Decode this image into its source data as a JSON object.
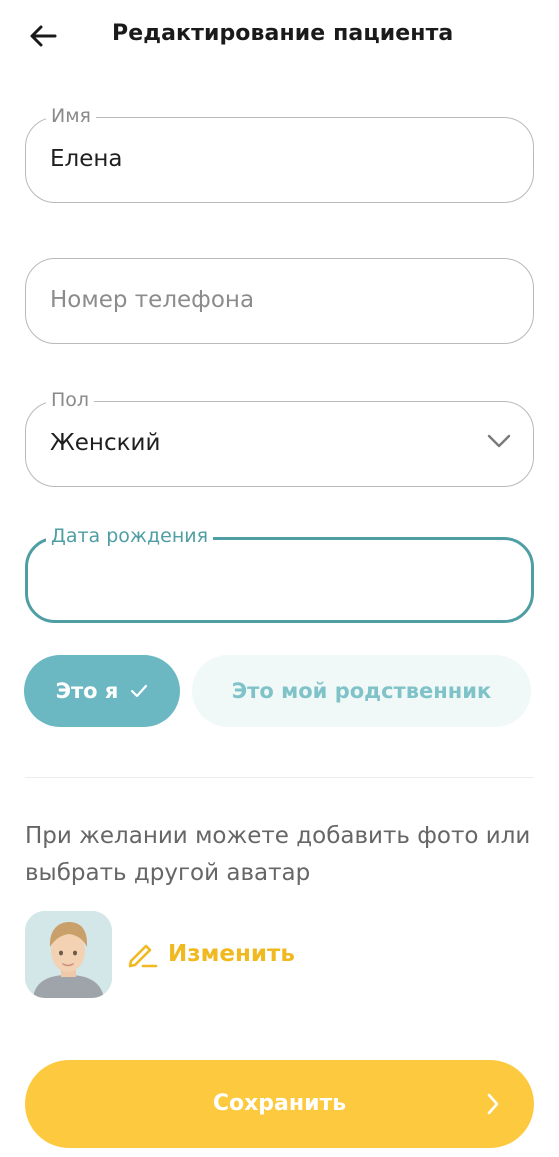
{
  "header": {
    "back_icon": "arrow-left-icon",
    "title": "Редактирование пациента"
  },
  "form": {
    "name": {
      "label": "Имя",
      "value": "Елена"
    },
    "phone": {
      "placeholder": "Номер телефона",
      "value": ""
    },
    "gender": {
      "label": "Пол",
      "value": "Женский",
      "icon": "chevron-down-icon"
    },
    "birth_date": {
      "label": "Дата рождения",
      "value": "",
      "state": "focused"
    }
  },
  "relation": {
    "me_label": "Это я",
    "me_icon": "check-icon",
    "me_selected": true,
    "relative_label": "Это мой родственник",
    "relative_selected": false
  },
  "avatar_section": {
    "hint": "При желании можете добавить фото или выбрать другой аватар",
    "avatar_icon": "avatar-image",
    "change_icon": "pencil-icon",
    "change_label": "Изменить"
  },
  "footer": {
    "save_label": "Сохранить",
    "save_icon": "chevron-right-icon"
  },
  "colors": {
    "accent_teal": "#4f9ea3",
    "chip_teal": "#6bb8c2",
    "chip_light": "#f0f8f8",
    "save_yellow": "#fdc93e",
    "link_yellow": "#efb91f"
  }
}
